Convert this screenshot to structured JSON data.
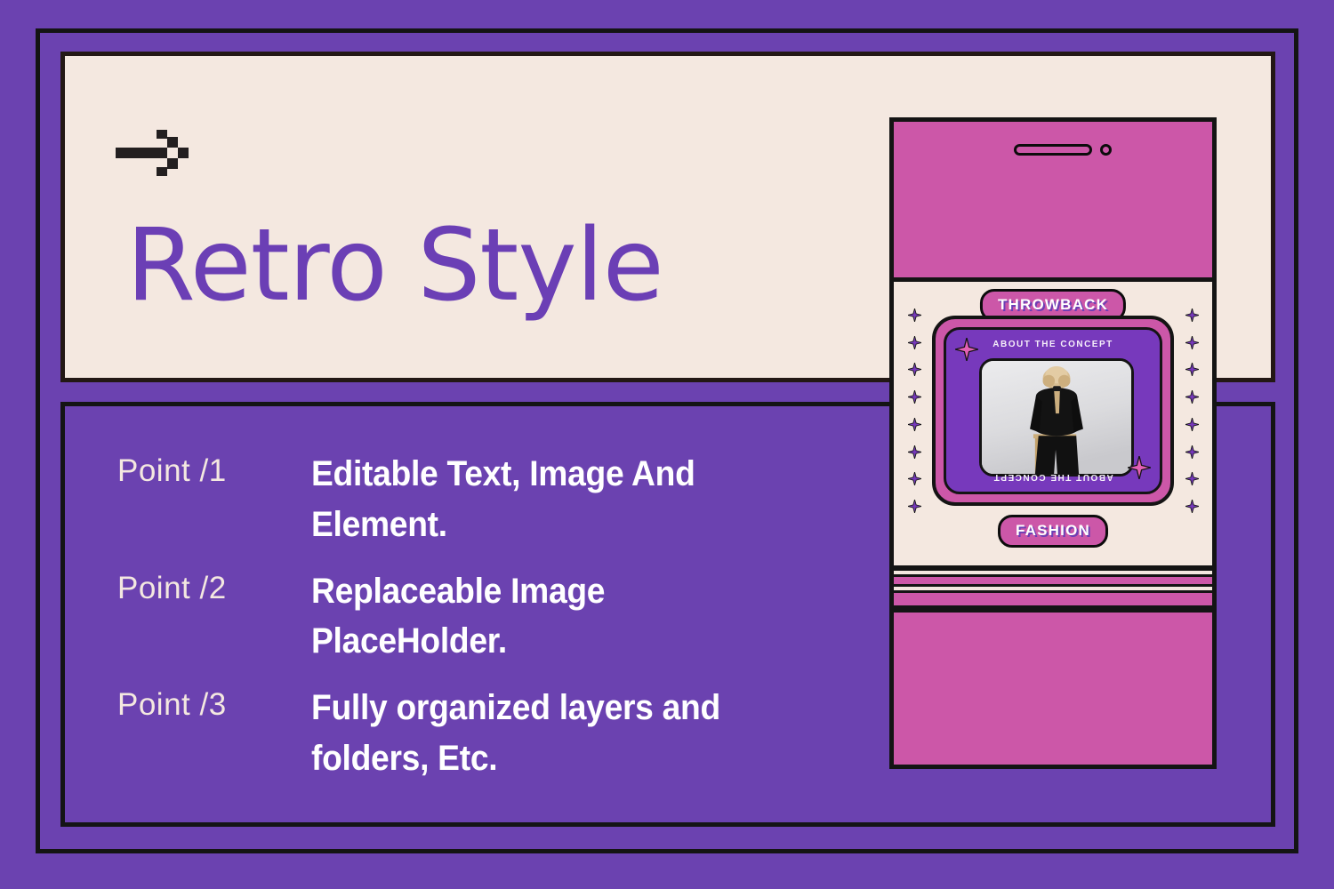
{
  "theme": {
    "purple": "#6B42B0",
    "purple_deep": "#7739BC",
    "title_purple": "#6B3FB5",
    "pink": "#CC57A8",
    "cream": "#F4E8E0",
    "ink": "#141414",
    "white": "#FFFFFF"
  },
  "header": {
    "icon": "pixel-arrow-icon",
    "title": "Retro Style"
  },
  "points": [
    {
      "label": "Point  /1",
      "text": "Editable Text, Image And Element."
    },
    {
      "label": "Point  /2",
      "text": "Replaceable Image PlaceHolder."
    },
    {
      "label": "Point  /3",
      "text": "Fully organized layers and folders, Etc."
    }
  ],
  "phone": {
    "speaker_icon": "speaker-grille-icon",
    "camera_icon": "camera-dot-icon",
    "badge_top": "THROWBACK",
    "badge_bottom": "FASHION",
    "card": {
      "caption_top": "ABOUT THE CONCEPT",
      "caption_bottom": "ABOUT THE CONCEPT",
      "star_icon": "four-point-star-icon",
      "photo_alt": "fashion-model-photo-placeholder"
    },
    "sparkle_icon": "four-point-star-icon",
    "sparkle_count_per_column": 8,
    "stripe_count": 3
  }
}
